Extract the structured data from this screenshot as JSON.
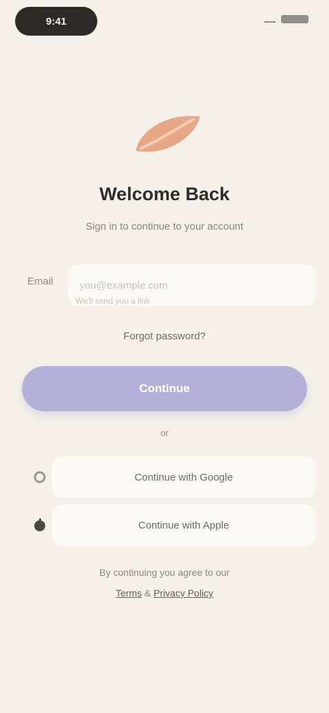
{
  "status_bar": {
    "time": "9:41"
  },
  "hero": {
    "title": "Welcome Back",
    "subtitle": "Sign in to continue to your account"
  },
  "form": {
    "email_label": "Email",
    "email_placeholder": "you@example.com",
    "email_value": "",
    "hint": "We'll send you a link",
    "forgot_link": "Forgot password?"
  },
  "actions": {
    "primary_label": "Continue",
    "divider_label": "or",
    "google_label": "Continue with Google",
    "apple_label": "Continue with Apple"
  },
  "footer": {
    "line1": "By continuing you agree to our",
    "terms": "Terms",
    "and": " & ",
    "privacy": "Privacy Policy"
  },
  "colors": {
    "background": "#f5f1ea",
    "accent": "#b3b1d9",
    "logo": "#e8a886"
  }
}
